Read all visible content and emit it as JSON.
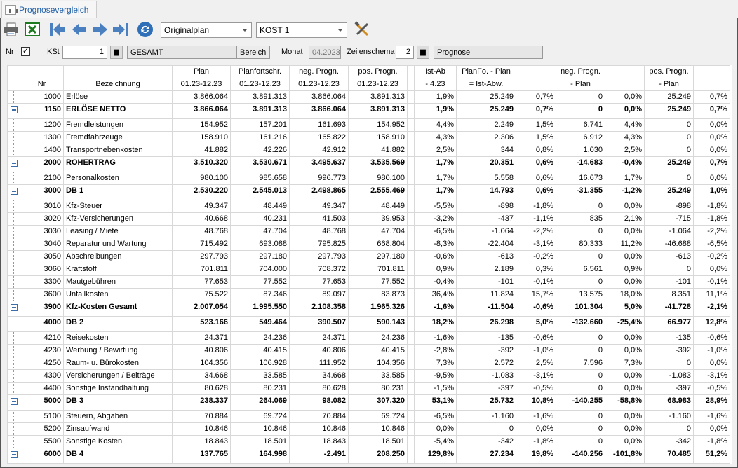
{
  "tab": {
    "title": "Prognosevergleich"
  },
  "toolbar": {
    "plan_select": "Originalplan",
    "kost_select": "KOST 1"
  },
  "filter": {
    "nr_label": "Nr",
    "nr_checked": true,
    "kst_label": "KSt",
    "kst_value": "1",
    "kst_name": "GESAMT",
    "bereich": "Bereich",
    "monat_label": "Monat",
    "monat_value": "04.2023",
    "zeilenschema_label": "Zeilenschema",
    "zeilenschema_value": "2",
    "zeilenschema_name": "Prognose"
  },
  "headers": {
    "row1": [
      "",
      "",
      "Plan",
      "Planfortschr.",
      "neg. Progn.",
      "pos. Progn.",
      "",
      "Ist-Ab",
      "PlanFo. - Plan",
      "",
      "neg. Progn.",
      "",
      "pos. Progn.",
      ""
    ],
    "row2": [
      "Nr",
      "Bezeichnung",
      "01.23-12.23",
      "01.23-12.23",
      "01.23-12.23",
      "01.23-12.23",
      "",
      "- 4.23",
      "= Ist-Abw.",
      "",
      "- Plan",
      "",
      "- Plan",
      ""
    ]
  },
  "rows": [
    {
      "type": "d",
      "c": [
        "1000",
        "Erlöse",
        "3.866.064",
        "3.891.313",
        "3.866.064",
        "3.891.313",
        "",
        "1,9%",
        "25.249",
        "0,7%",
        "0",
        "0,0%",
        "25.249",
        "0,7%"
      ]
    },
    {
      "type": "g",
      "c": [
        "1150",
        "ERLÖSE NETTO",
        "3.866.064",
        "3.891.313",
        "3.866.064",
        "3.891.313",
        "",
        "1,9%",
        "25.249",
        "0,7%",
        "0",
        "0,0%",
        "25.249",
        "0,7%"
      ]
    },
    {
      "type": "d",
      "c": [
        "1200",
        "Fremdleistungen",
        "154.952",
        "157.201",
        "161.693",
        "154.952",
        "",
        "4,4%",
        "2.249",
        "1,5%",
        "6.741",
        "4,4%",
        "0",
        "0,0%"
      ]
    },
    {
      "type": "d",
      "c": [
        "1300",
        "Fremdfahrzeuge",
        "158.910",
        "161.216",
        "165.822",
        "158.910",
        "",
        "4,3%",
        "2.306",
        "1,5%",
        "6.912",
        "4,3%",
        "0",
        "0,0%"
      ]
    },
    {
      "type": "d",
      "c": [
        "1400",
        "Transportnebenkosten",
        "41.882",
        "42.226",
        "42.912",
        "41.882",
        "",
        "2,5%",
        "344",
        "0,8%",
        "1.030",
        "2,5%",
        "0",
        "0,0%"
      ]
    },
    {
      "type": "g",
      "c": [
        "2000",
        "ROHERTRAG",
        "3.510.320",
        "3.530.671",
        "3.495.637",
        "3.535.569",
        "",
        "1,7%",
        "20.351",
        "0,6%",
        "-14.683",
        "-0,4%",
        "25.249",
        "0,7%"
      ]
    },
    {
      "type": "d",
      "c": [
        "2100",
        "Personalkosten",
        "980.100",
        "985.658",
        "996.773",
        "980.100",
        "",
        "1,7%",
        "5.558",
        "0,6%",
        "16.673",
        "1,7%",
        "0",
        "0,0%"
      ]
    },
    {
      "type": "g",
      "c": [
        "3000",
        "DB 1",
        "2.530.220",
        "2.545.013",
        "2.498.865",
        "2.555.469",
        "",
        "1,7%",
        "14.793",
        "0,6%",
        "-31.355",
        "-1,2%",
        "25.249",
        "1,0%"
      ]
    },
    {
      "type": "d",
      "c": [
        "3010",
        "Kfz-Steuer",
        "49.347",
        "48.449",
        "49.347",
        "48.449",
        "",
        "-5,5%",
        "-898",
        "-1,8%",
        "0",
        "0,0%",
        "-898",
        "-1,8%"
      ]
    },
    {
      "type": "d",
      "c": [
        "3020",
        "Kfz-Versicherungen",
        "40.668",
        "40.231",
        "41.503",
        "39.953",
        "",
        "-3,2%",
        "-437",
        "-1,1%",
        "835",
        "2,1%",
        "-715",
        "-1,8%"
      ]
    },
    {
      "type": "d",
      "c": [
        "3030",
        "Leasing / Miete",
        "48.768",
        "47.704",
        "48.768",
        "47.704",
        "",
        "-6,5%",
        "-1.064",
        "-2,2%",
        "0",
        "0,0%",
        "-1.064",
        "-2,2%"
      ]
    },
    {
      "type": "d",
      "c": [
        "3040",
        "Reparatur und Wartung",
        "715.492",
        "693.088",
        "795.825",
        "668.804",
        "",
        "-8,3%",
        "-22.404",
        "-3,1%",
        "80.333",
        "11,2%",
        "-46.688",
        "-6,5%"
      ]
    },
    {
      "type": "d",
      "c": [
        "3050",
        "Abschreibungen",
        "297.793",
        "297.180",
        "297.793",
        "297.180",
        "",
        "-0,6%",
        "-613",
        "-0,2%",
        "0",
        "0,0%",
        "-613",
        "-0,2%"
      ]
    },
    {
      "type": "d",
      "c": [
        "3060",
        "Kraftstoff",
        "701.811",
        "704.000",
        "708.372",
        "701.811",
        "",
        "0,9%",
        "2.189",
        "0,3%",
        "6.561",
        "0,9%",
        "0",
        "0,0%"
      ]
    },
    {
      "type": "d",
      "c": [
        "3300",
        "Mautgebühren",
        "77.653",
        "77.552",
        "77.653",
        "77.552",
        "",
        "-0,4%",
        "-101",
        "-0,1%",
        "0",
        "0,0%",
        "-101",
        "-0,1%"
      ]
    },
    {
      "type": "d",
      "c": [
        "3600",
        "Unfallkosten",
        "75.522",
        "87.346",
        "89.097",
        "83.873",
        "",
        "36,4%",
        "11.824",
        "15,7%",
        "13.575",
        "18,0%",
        "8.351",
        "11,1%"
      ]
    },
    {
      "type": "g",
      "c": [
        "3900",
        "Kfz-Kosten Gesamt",
        "2.007.054",
        "1.995.550",
        "2.108.358",
        "1.965.326",
        "",
        "-1,6%",
        "-11.504",
        "-0,6%",
        "101.304",
        "5,0%",
        "-41.728",
        "-2,1%"
      ]
    },
    {
      "type": "b",
      "c": [
        "4000",
        "DB 2",
        "523.166",
        "549.464",
        "390.507",
        "590.143",
        "",
        "18,2%",
        "26.298",
        "5,0%",
        "-132.660",
        "-25,4%",
        "66.977",
        "12,8%"
      ]
    },
    {
      "type": "d",
      "c": [
        "4210",
        "Reisekosten",
        "24.371",
        "24.236",
        "24.371",
        "24.236",
        "",
        "-1,6%",
        "-135",
        "-0,6%",
        "0",
        "0,0%",
        "-135",
        "-0,6%"
      ]
    },
    {
      "type": "d",
      "c": [
        "4230",
        "Werbung / Bewirtung",
        "40.806",
        "40.415",
        "40.806",
        "40.415",
        "",
        "-2,8%",
        "-392",
        "-1,0%",
        "0",
        "0,0%",
        "-392",
        "-1,0%"
      ]
    },
    {
      "type": "d",
      "c": [
        "4250",
        "Raum- u. Bürokosten",
        "104.356",
        "106.928",
        "111.952",
        "104.356",
        "",
        "7,3%",
        "2.572",
        "2,5%",
        "7.596",
        "7,3%",
        "0",
        "0,0%"
      ]
    },
    {
      "type": "d",
      "c": [
        "4300",
        "Versicherungen / Beiträge",
        "34.668",
        "33.585",
        "34.668",
        "33.585",
        "",
        "-9,5%",
        "-1.083",
        "-3,1%",
        "0",
        "0,0%",
        "-1.083",
        "-3,1%"
      ]
    },
    {
      "type": "d",
      "c": [
        "4400",
        "Sonstige Instandhaltung",
        "80.628",
        "80.231",
        "80.628",
        "80.231",
        "",
        "-1,5%",
        "-397",
        "-0,5%",
        "0",
        "0,0%",
        "-397",
        "-0,5%"
      ]
    },
    {
      "type": "g",
      "c": [
        "5000",
        "DB 3",
        "238.337",
        "264.069",
        "98.082",
        "307.320",
        "",
        "53,1%",
        "25.732",
        "10,8%",
        "-140.255",
        "-58,8%",
        "68.983",
        "28,9%"
      ]
    },
    {
      "type": "d",
      "c": [
        "5100",
        "Steuern, Abgaben",
        "70.884",
        "69.724",
        "70.884",
        "69.724",
        "",
        "-6,5%",
        "-1.160",
        "-1,6%",
        "0",
        "0,0%",
        "-1.160",
        "-1,6%"
      ]
    },
    {
      "type": "d",
      "c": [
        "5200",
        "Zinsaufwand",
        "10.846",
        "10.846",
        "10.846",
        "10.846",
        "",
        "0,0%",
        "0",
        "0,0%",
        "0",
        "0,0%",
        "0",
        "0,0%"
      ]
    },
    {
      "type": "d",
      "c": [
        "5500",
        "Sonstige Kosten",
        "18.843",
        "18.501",
        "18.843",
        "18.501",
        "",
        "-5,4%",
        "-342",
        "-1,8%",
        "0",
        "0,0%",
        "-342",
        "-1,8%"
      ]
    },
    {
      "type": "g",
      "c": [
        "6000",
        "DB 4",
        "137.765",
        "164.998",
        "-2.491",
        "208.250",
        "",
        "129,8%",
        "27.234",
        "19,8%",
        "-140.256",
        "-101,8%",
        "70.485",
        "51,2%"
      ]
    }
  ]
}
